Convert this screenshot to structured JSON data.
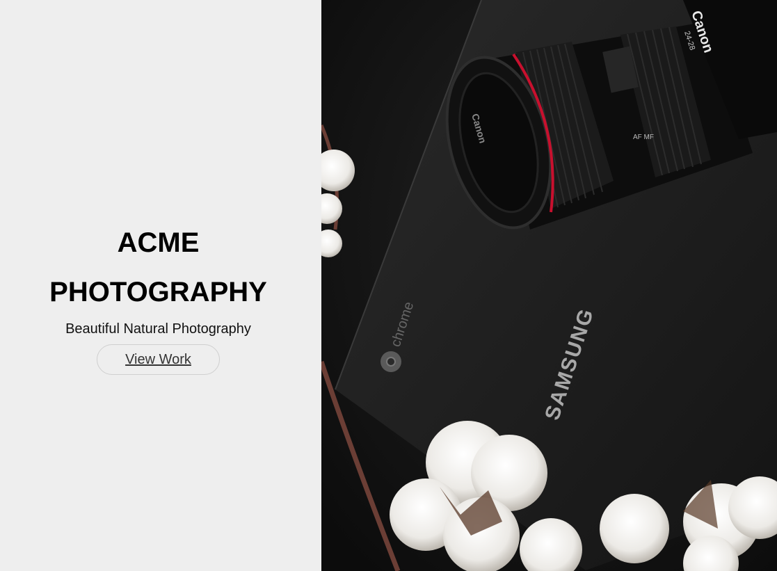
{
  "hero": {
    "title_line1": "ACME",
    "title_line2": "PHOTOGRAPHY",
    "subtitle": "Beautiful Natural Photography",
    "button_label": "View Work"
  },
  "photo": {
    "lens_brand": "Canon",
    "lens_spec": "24-28",
    "laptop_brand": "SAMSUNG",
    "laptop_os": "chrome",
    "lens_mode_label": "AF  MF"
  },
  "colors": {
    "left_bg": "#eeeeee",
    "photo_bg": "#141414",
    "lens_red": "#c8102e"
  }
}
